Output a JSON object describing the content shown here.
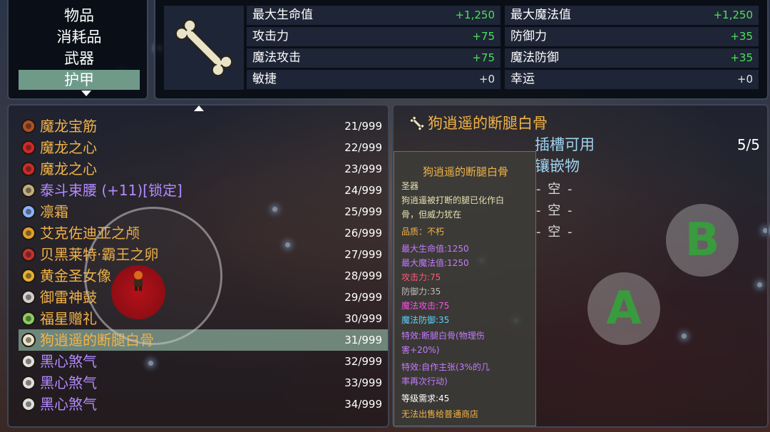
{
  "categories": {
    "items": [
      "物品",
      "消耗品",
      "武器",
      "护甲"
    ],
    "active_index": 3
  },
  "stats": {
    "rows": [
      {
        "left_label": "最大生命值",
        "left_value": "+1,250",
        "right_label": "最大魔法值",
        "right_value": "+1,250"
      },
      {
        "left_label": "攻击力",
        "left_value": "+75",
        "right_label": "防御力",
        "right_value": "+35"
      },
      {
        "left_label": "魔法攻击",
        "left_value": "+75",
        "right_label": "魔法防御",
        "right_value": "+35"
      },
      {
        "left_label": "敏捷",
        "left_value": "+0",
        "right_label": "幸运",
        "right_value": "+0"
      }
    ],
    "icon": "bone-icon"
  },
  "item_list": {
    "items": [
      {
        "name": "魔龙宝筋",
        "count": "21/999",
        "color": "#f2b347",
        "icon": "ring-icon"
      },
      {
        "name": "魔龙之心",
        "count": "22/999",
        "color": "#f2b347",
        "icon": "heart-icon"
      },
      {
        "name": "魔龙之心",
        "count": "23/999",
        "color": "#f2b347",
        "icon": "heart-icon"
      },
      {
        "name": "泰斗束腰 (+11)[锁定]",
        "count": "24/999",
        "color": "#b48aff",
        "icon": "belt-icon"
      },
      {
        "name": "凛霜",
        "count": "25/999",
        "color": "#f2b347",
        "icon": "frost-icon"
      },
      {
        "name": "艾克佐迪亚之颅",
        "count": "26/999",
        "color": "#f2b347",
        "icon": "skull-icon"
      },
      {
        "name": "贝黑莱特·霸王之卵",
        "count": "27/999",
        "color": "#f2b347",
        "icon": "egg-icon"
      },
      {
        "name": "黄金圣女像",
        "count": "28/999",
        "color": "#f2b347",
        "icon": "statue-icon"
      },
      {
        "name": "御雷神鼓",
        "count": "29/999",
        "color": "#f2b347",
        "icon": "drum-icon"
      },
      {
        "name": "福星赠礼",
        "count": "30/999",
        "color": "#f2b347",
        "icon": "gift-icon"
      },
      {
        "name": "狗逍遥的断腿白骨",
        "count": "31/999",
        "color": "#f2b347",
        "icon": "bone-icon"
      },
      {
        "name": "黑心煞气",
        "count": "32/999",
        "color": "#b48aff",
        "icon": "bowl-icon"
      },
      {
        "name": "黑心煞气",
        "count": "33/999",
        "color": "#b48aff",
        "icon": "bowl-icon"
      },
      {
        "name": "黑心煞气",
        "count": "34/999",
        "color": "#b48aff",
        "icon": "bowl-icon"
      }
    ],
    "selected_index": 10
  },
  "detail": {
    "title": "狗逍遥的断腿白骨",
    "slots_label": "插槽可用",
    "slots_value": "5/5",
    "gems_label": "镶嵌物",
    "empty_slots": [
      "- 空 -",
      "- 空 -",
      "- 空 -"
    ],
    "tooltip": {
      "title": "狗逍遥的断腿白骨",
      "lines": [
        {
          "text": "圣器",
          "color": "#e8e0b0"
        },
        {
          "text": "狗逍遥被打断的腿已化作白",
          "color": "#e8e0b0"
        },
        {
          "text": "骨，但威力犹在",
          "color": "#e8e0b0"
        },
        {
          "text": "品质：不朽",
          "color": "#f2b347"
        },
        {
          "text": "最大生命值:1250",
          "color": "#c37bff"
        },
        {
          "text": "最大魔法值:1250",
          "color": "#c37bff"
        },
        {
          "text": "攻击力:75",
          "color": "#ff5a7a"
        },
        {
          "text": "防御力:35",
          "color": "#bdbdbd"
        },
        {
          "text": "魔法攻击:75",
          "color": "#ff4df0"
        },
        {
          "text": "魔法防御:35",
          "color": "#5fd0ff"
        },
        {
          "text": "特效:断腿白骨(物理伤",
          "color": "#c37bff"
        },
        {
          "text": "害+20%)",
          "color": "#c37bff"
        },
        {
          "text": "特效:自作主张(3%的几",
          "color": "#c37bff"
        },
        {
          "text": "率再次行动)",
          "color": "#c37bff"
        },
        {
          "text": "等级需求:45",
          "color": "#ffffff"
        },
        {
          "text": "无法出售给普通商店",
          "color": "#f2b347"
        }
      ]
    }
  },
  "controls": {
    "button_a": "A",
    "button_b": "B"
  }
}
